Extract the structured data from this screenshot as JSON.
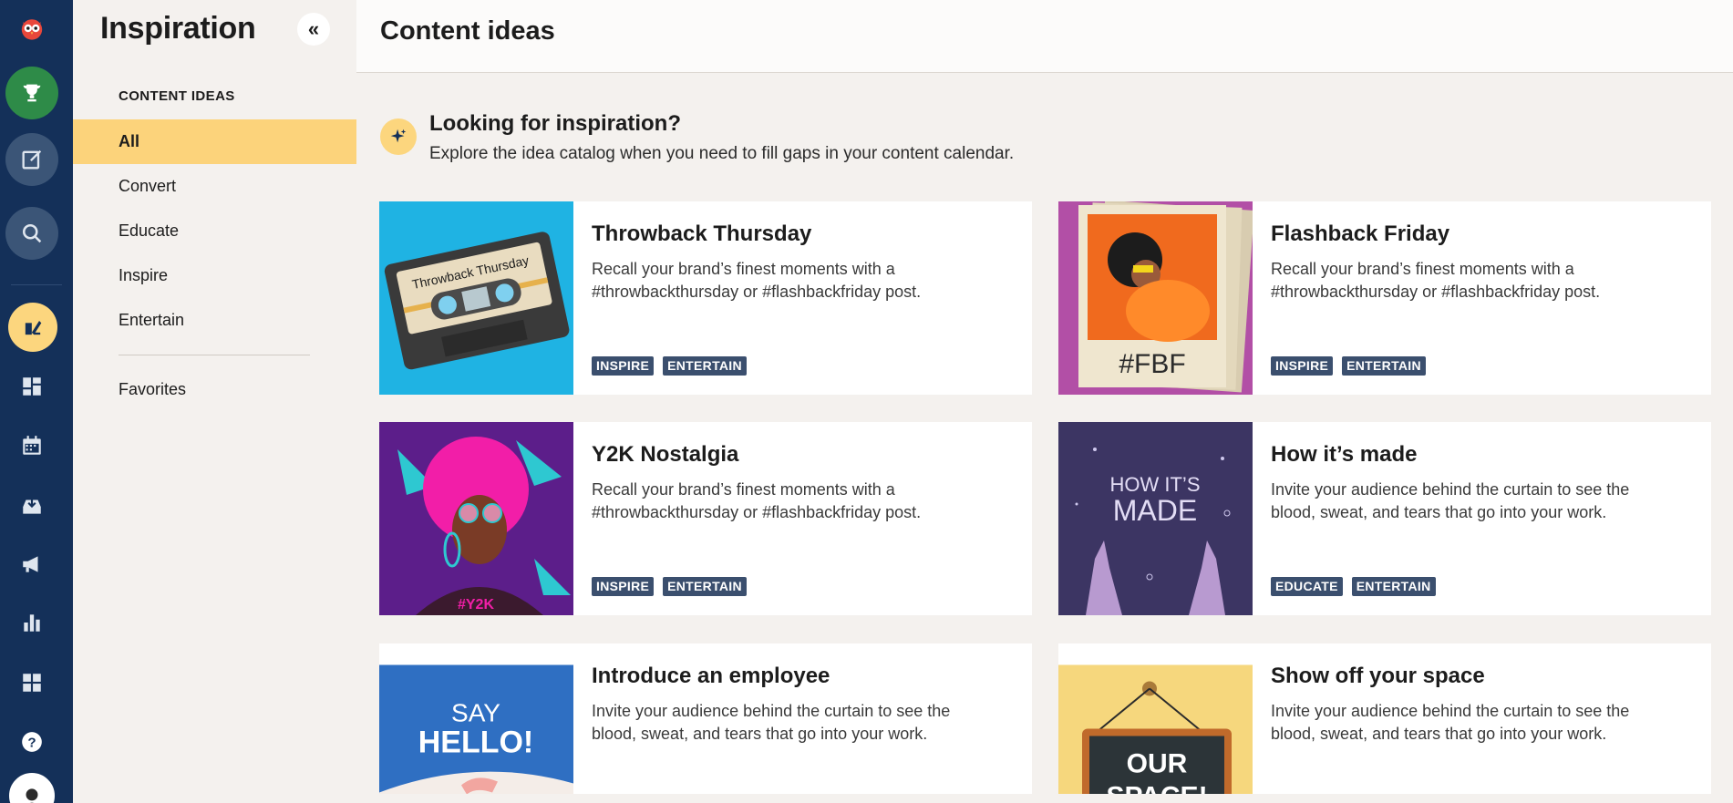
{
  "sidebar": {
    "title": "Inspiration",
    "collapse_label": "«",
    "section_label": "CONTENT IDEAS",
    "items": [
      {
        "label": "All"
      },
      {
        "label": "Convert"
      },
      {
        "label": "Educate"
      },
      {
        "label": "Inspire"
      },
      {
        "label": "Entertain"
      },
      {
        "label": "Favorites"
      }
    ]
  },
  "main": {
    "title": "Content ideas",
    "intro": {
      "heading": "Looking for inspiration?",
      "subtext": "Explore the idea catalog when you need to fill gaps in your content calendar."
    },
    "cards": [
      {
        "title": "Throwback Thursday",
        "description": "Recall your brand’s finest moments with a #throwbackthursday or #flashbackfriday post.",
        "tags": [
          "INSPIRE",
          "ENTERTAIN"
        ],
        "image_text": "Throwback Thursday"
      },
      {
        "title": "Flashback Friday",
        "description": "Recall your brand’s finest moments with a #throwbackthursday or #flashbackfriday post.",
        "tags": [
          "INSPIRE",
          "ENTERTAIN"
        ],
        "image_text": "#FBF"
      },
      {
        "title": "Y2K Nostalgia",
        "description": "Recall your brand’s finest moments with a #throwbackthursday or #flashbackfriday post.",
        "tags": [
          "INSPIRE",
          "ENTERTAIN"
        ],
        "image_text": "#Y2K"
      },
      {
        "title": "How it’s made",
        "description": "Invite your audience behind the curtain to see the blood, sweat, and tears that go into your work.",
        "tags": [
          "EDUCATE",
          "ENTERTAIN"
        ],
        "image_text_1": "HOW IT’S",
        "image_text_2": "MADE"
      },
      {
        "title": "Introduce an employee",
        "description": "Invite your audience behind the curtain to see the blood, sweat, and tears that go into your work.",
        "tags": [],
        "image_text_1": "SAY",
        "image_text_2": "HELLO!"
      },
      {
        "title": "Show off your space",
        "description": "Invite your audience behind the curtain to see the blood, sweat, and tears that go into your work.",
        "tags": [],
        "image_text_1": "OUR",
        "image_text_2": "SPACE!"
      }
    ]
  },
  "rail": {
    "icons": [
      "owl-logo-icon",
      "trophy-icon",
      "compose-icon",
      "search-icon",
      "inspiration-icon",
      "dashboard-icon",
      "calendar-icon",
      "inbox-icon",
      "megaphone-icon",
      "analytics-icon",
      "apps-icon",
      "help-icon",
      "avatar-icon"
    ]
  },
  "colors": {
    "rail_bg": "#143059",
    "active_nav": "#fcd37b",
    "tag_bg": "#3b4f6e",
    "trophy_bg": "#2e8b48"
  }
}
